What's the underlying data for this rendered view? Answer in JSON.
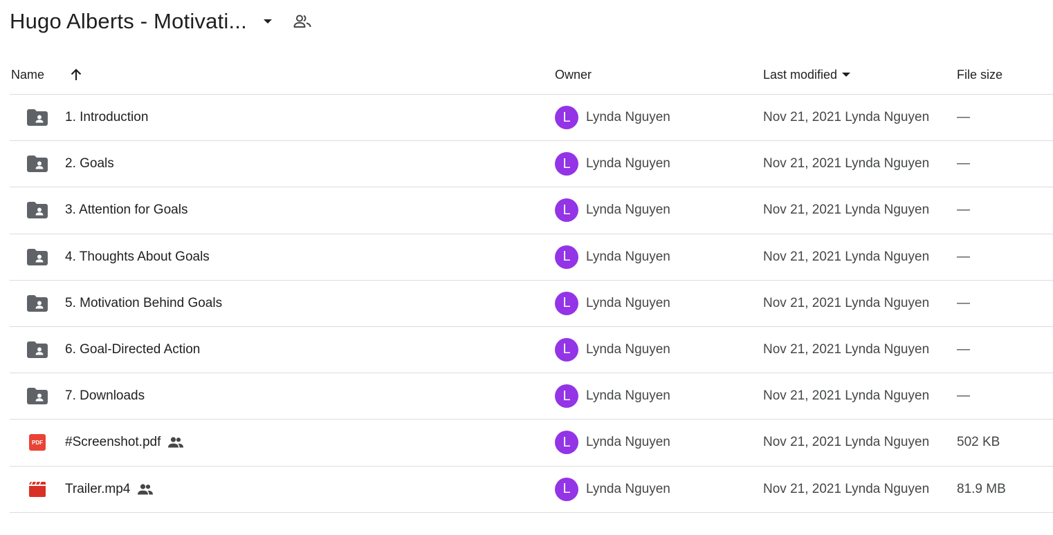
{
  "header": {
    "folder_title": "Hugo Alberts - Motivati..."
  },
  "columns": {
    "name": "Name",
    "owner": "Owner",
    "last_modified": "Last modified",
    "file_size": "File size"
  },
  "colors": {
    "avatar": "#9334e6",
    "folder_icon": "#5f6368",
    "pdf_icon": "#ea4335",
    "video_icon": "#d93025"
  },
  "rows": [
    {
      "icon": "folder-shared-icon",
      "name": "1. Introduction",
      "shared": false,
      "owner_initial": "L",
      "owner": "Lynda Nguyen",
      "modified": "Nov 21, 2021 Lynda Nguyen",
      "size": "—"
    },
    {
      "icon": "folder-shared-icon",
      "name": "2. Goals",
      "shared": false,
      "owner_initial": "L",
      "owner": "Lynda Nguyen",
      "modified": "Nov 21, 2021 Lynda Nguyen",
      "size": "—"
    },
    {
      "icon": "folder-shared-icon",
      "name": "3. Attention for Goals",
      "shared": false,
      "owner_initial": "L",
      "owner": "Lynda Nguyen",
      "modified": "Nov 21, 2021 Lynda Nguyen",
      "size": "—"
    },
    {
      "icon": "folder-shared-icon",
      "name": "4. Thoughts About Goals",
      "shared": false,
      "owner_initial": "L",
      "owner": "Lynda Nguyen",
      "modified": "Nov 21, 2021 Lynda Nguyen",
      "size": "—"
    },
    {
      "icon": "folder-shared-icon",
      "name": "5. Motivation Behind Goals",
      "shared": false,
      "owner_initial": "L",
      "owner": "Lynda Nguyen",
      "modified": "Nov 21, 2021 Lynda Nguyen",
      "size": "—"
    },
    {
      "icon": "folder-shared-icon",
      "name": "6. Goal-Directed Action",
      "shared": false,
      "owner_initial": "L",
      "owner": "Lynda Nguyen",
      "modified": "Nov 21, 2021 Lynda Nguyen",
      "size": "—"
    },
    {
      "icon": "folder-shared-icon",
      "name": "7. Downloads",
      "shared": false,
      "owner_initial": "L",
      "owner": "Lynda Nguyen",
      "modified": "Nov 21, 2021 Lynda Nguyen",
      "size": "—"
    },
    {
      "icon": "pdf-icon",
      "icon_text": "PDF",
      "name": "#Screenshot.pdf",
      "shared": true,
      "owner_initial": "L",
      "owner": "Lynda Nguyen",
      "modified": "Nov 21, 2021 Lynda Nguyen",
      "size": "502 KB"
    },
    {
      "icon": "video-icon",
      "name": "Trailer.mp4",
      "shared": true,
      "owner_initial": "L",
      "owner": "Lynda Nguyen",
      "modified": "Nov 21, 2021 Lynda Nguyen",
      "size": "81.9 MB"
    }
  ]
}
